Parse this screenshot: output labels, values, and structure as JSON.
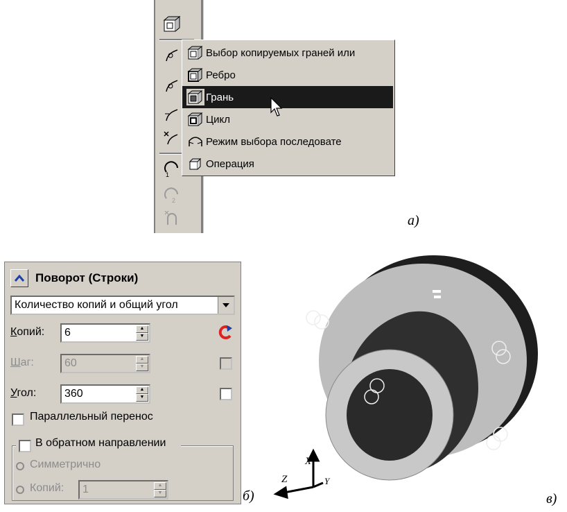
{
  "menu": {
    "items": [
      {
        "label": "Выбор копируемых граней или",
        "icon": "face-select-icon"
      },
      {
        "label": "Ребро",
        "icon": "edge-icon"
      },
      {
        "label": "Грань",
        "icon": "face-icon",
        "selected": true
      },
      {
        "label": "Цикл",
        "icon": "loop-icon"
      },
      {
        "label": "Режим выбора последовате",
        "icon": "sequential-select-icon"
      },
      {
        "label": "Операция",
        "icon": "operation-icon"
      }
    ]
  },
  "panel": {
    "title": "Поворот (Строки)",
    "mode": "Количество копий и общий угол",
    "copies": {
      "label_first": "К",
      "label_rest": "опий:",
      "value": "6"
    },
    "step": {
      "label_first": "Ш",
      "label_rest": "аг:",
      "value": "60"
    },
    "angle": {
      "label_first": "У",
      "label_rest": "гол:",
      "value": "360"
    },
    "parallel_label": "Параллельный перенос",
    "reverse_label": "В обратном направлении",
    "symmetric_label": "Симметрично",
    "copies2": {
      "label": "Копий:",
      "value": "1"
    }
  },
  "captions": {
    "a": "а)",
    "b": "б)",
    "v": "в)"
  },
  "axes": {
    "x": "X",
    "y": "Y",
    "z": "Z"
  },
  "colors": {
    "menu_bg": "#d4d0c8",
    "selection": "#1a1a1a",
    "part_body": "#3a3a3a",
    "part_face": "#bfbfbf"
  }
}
